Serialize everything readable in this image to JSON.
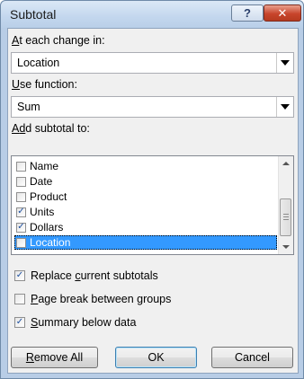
{
  "window": {
    "title": "Subtotal"
  },
  "titlebar": {
    "help_glyph": "?",
    "close_glyph": "✕"
  },
  "group_by": {
    "label_prefix": "A",
    "label_rest": "t each change in:",
    "value": "Location"
  },
  "function": {
    "label_prefix": "U",
    "label_rest": "se function:",
    "value": "Sum"
  },
  "subtotal_to": {
    "label_a": "A",
    "label_d": "d",
    "label_rest": "d subtotal to:",
    "items": [
      {
        "label": "Name",
        "checked": false,
        "selected": false
      },
      {
        "label": "Date",
        "checked": false,
        "selected": false
      },
      {
        "label": "Product",
        "checked": false,
        "selected": false
      },
      {
        "label": "Units",
        "checked": true,
        "selected": false
      },
      {
        "label": "Dollars",
        "checked": true,
        "selected": false
      },
      {
        "label": "Location",
        "checked": false,
        "selected": true
      }
    ]
  },
  "options": {
    "replace": {
      "pre": "Replace ",
      "u": "c",
      "post": "urrent subtotals",
      "checked": true
    },
    "page_break": {
      "pre": "",
      "u": "P",
      "post": "age break between groups",
      "checked": false
    },
    "summary": {
      "pre": "",
      "u": "S",
      "post": "ummary below data",
      "checked": true
    }
  },
  "buttons": {
    "remove_u": "R",
    "remove_rest": "emove All",
    "ok": "OK",
    "cancel": "Cancel"
  },
  "check_glyph": "✓",
  "colors": {
    "selection": "#3399ff",
    "close": "#c8452c"
  }
}
